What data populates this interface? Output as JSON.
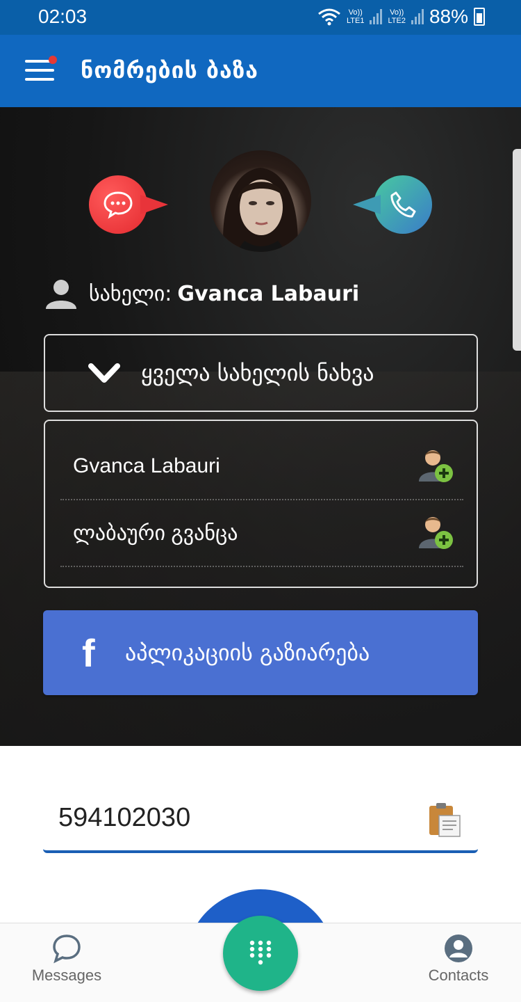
{
  "status_bar": {
    "time": "02:03",
    "sim1": "Vo))\nLTE1",
    "sim2": "Vo))\nLTE2",
    "battery": "88%"
  },
  "app_bar": {
    "title": "ნომრების ბაზა",
    "menu_icon": "hamburger-icon"
  },
  "profile": {
    "message_icon": "chat-bubble-icon",
    "call_icon": "phone-icon",
    "name_label": "სახელი:",
    "name_value": "Gvanca Labauri"
  },
  "expand": {
    "label": "ყველა სახელის ნახვა",
    "icon": "chevron-down-icon"
  },
  "names": [
    {
      "text": "Gvanca Labauri",
      "icon": "add-contact-icon"
    },
    {
      "text": "ლაბაური გვანცა",
      "icon": "add-contact-icon"
    }
  ],
  "share": {
    "icon_text": "f",
    "label": "აპლიკაციის გაზიარება"
  },
  "number_input": {
    "value": "594102030",
    "icon": "clipboard-icon"
  },
  "bottom_nav": {
    "messages": "Messages",
    "contacts": "Contacts",
    "dialpad_icon": "dialpad-icon"
  },
  "colors": {
    "status_bar": "#0a5fa8",
    "app_bar": "#1068c0",
    "share_button": "#4a70d2",
    "fab": "#1fb489",
    "message_bubble": "#e8343a"
  }
}
